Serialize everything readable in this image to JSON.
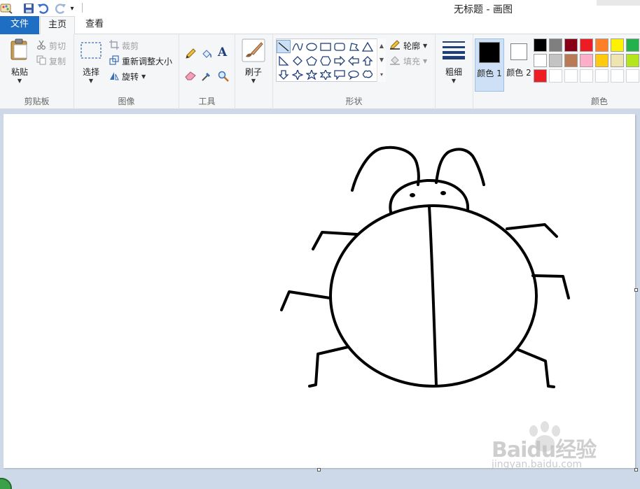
{
  "window": {
    "title": "无标题 - 画图"
  },
  "quick_access": {
    "app_icon": "paint-app-icon",
    "save_icon": "floppy-disk-icon",
    "undo_icon": "undo-icon",
    "redo_icon": "redo-icon",
    "customize_label": "▾"
  },
  "tabs": [
    {
      "label": "文件",
      "state": "file"
    },
    {
      "label": "主页",
      "state": "selected"
    },
    {
      "label": "查看",
      "state": "normal"
    }
  ],
  "ribbon": {
    "clipboard": {
      "group_label": "剪贴板",
      "paste_label": "粘贴",
      "cut_label": "剪切",
      "copy_label": "复制"
    },
    "image": {
      "group_label": "图像",
      "select_label": "选择",
      "crop_label": "裁剪",
      "resize_label": "重新调整大小",
      "rotate_label": "旋转"
    },
    "tools": {
      "group_label": "工具",
      "items": [
        "pencil-icon",
        "fill-bucket-icon",
        "text-icon",
        "eraser-icon",
        "color-picker-icon",
        "magnifier-icon"
      ]
    },
    "brushes": {
      "label": "刷子"
    },
    "shapes": {
      "group_label": "形状",
      "outline_label": "轮廓",
      "fill_label": "填充",
      "selected": "line"
    },
    "size": {
      "label": "粗细"
    },
    "colors": {
      "group_label": "颜色",
      "color1_label": "颜色 1",
      "color2_label": "颜色 2",
      "color1": "#000000",
      "color2": "#ffffff",
      "palette_row1": [
        "#000000",
        "#7f7f7f",
        "#880015",
        "#ed1c24",
        "#ff7f27",
        "#fff200",
        "#22b14c"
      ],
      "palette_row2": [
        "#ffffff",
        "#c3c3c3",
        "#b97a57",
        "#ffaec9",
        "#ffc90e",
        "#efe4b0",
        "#b5e61d"
      ],
      "palette_row3": [
        "#ee1c23",
        "",
        "",
        "",
        "",
        "",
        ""
      ]
    }
  },
  "canvas": {
    "drawing": "bug-drawing"
  },
  "watermark": {
    "text": "Baidu经验",
    "url": "jingyan.baidu.com"
  }
}
